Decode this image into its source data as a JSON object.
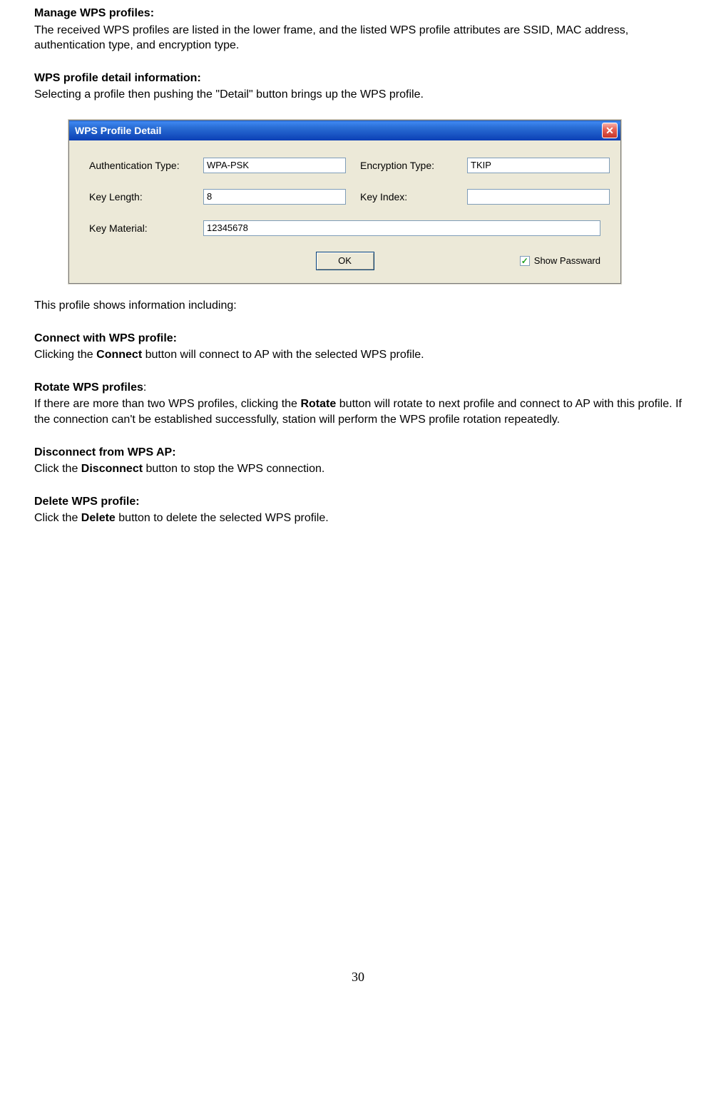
{
  "sections": {
    "manage": {
      "heading": "Manage WPS profiles:",
      "body": "The received WPS profiles are listed in the lower frame, and the listed WPS profile attributes are SSID, MAC address, authentication type, and encryption type."
    },
    "detail_info": {
      "heading": "WPS profile detail information:",
      "body": "Selecting a profile then pushing the \"Detail\" button brings up the WPS profile."
    },
    "profile_includes": "This profile shows information including:",
    "connect": {
      "heading": "Connect with WPS profile:",
      "body_pre": "Clicking the ",
      "body_bold": "Connect",
      "body_post": " button will connect to AP with the selected WPS profile."
    },
    "rotate": {
      "heading_pre": "Rotate WPS profiles",
      "heading_post": ":",
      "body_pre": "If there are more than two WPS profiles, clicking the ",
      "body_bold": "Rotate",
      "body_post": " button will rotate to next profile and connect to AP with this profile. If the connection can't be established successfully, station will perform the WPS profile rotation repeatedly."
    },
    "disconnect": {
      "heading": "Disconnect from WPS AP:",
      "body_pre": "Click the ",
      "body_bold": "Disconnect",
      "body_post": " button to stop the WPS connection."
    },
    "delete": {
      "heading": "Delete WPS profile:",
      "body_pre": "Click the ",
      "body_bold": "Delete",
      "body_post": " button to delete the selected WPS profile."
    }
  },
  "dialog": {
    "title": "WPS Profile Detail",
    "close_glyph": "✕",
    "fields": {
      "auth_type": {
        "label": "Authentication Type:",
        "value": "WPA-PSK"
      },
      "enc_type": {
        "label": "Encryption Type:",
        "value": "TKIP"
      },
      "key_length": {
        "label": "Key Length:",
        "value": "8"
      },
      "key_index": {
        "label": "Key Index:",
        "value": ""
      },
      "key_material": {
        "label": "Key Material:",
        "value": "12345678"
      }
    },
    "ok_label": "OK",
    "show_password": {
      "label": "Show Passward",
      "checked": true,
      "check_glyph": "✓"
    }
  },
  "page_number": "30"
}
